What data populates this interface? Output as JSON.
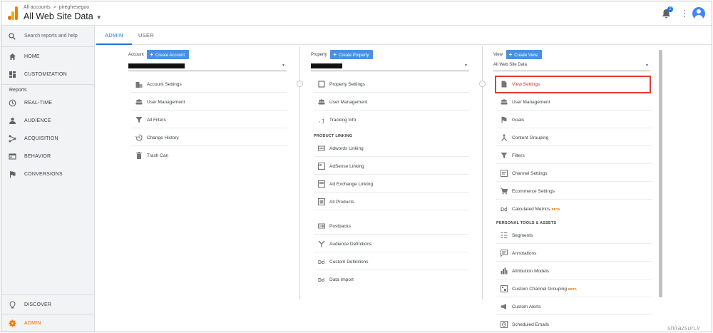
{
  "header": {
    "breadcrumb": [
      "All accounts",
      ">",
      "pireghesegoo"
    ],
    "title": "All Web Site Data",
    "notification_count": "2"
  },
  "search": {
    "placeholder": "Search reports and help"
  },
  "sidebar": {
    "home": "HOME",
    "customization": "CUSTOMIZATION",
    "reports_heading": "Reports",
    "realtime": "REAL-TIME",
    "audience": "AUDIENCE",
    "acquisition": "ACQUISITION",
    "behavior": "BEHAVIOR",
    "conversions": "CONVERSIONS",
    "discover": "DISCOVER",
    "admin": "ADMIN"
  },
  "tabs": {
    "admin": "ADMIN",
    "user": "USER"
  },
  "account": {
    "label": "Account",
    "create": "Create Account",
    "items": [
      "Account Settings",
      "User Management",
      "All Filters",
      "Change History",
      "Trash Can"
    ]
  },
  "property": {
    "label": "Property",
    "create": "Create Property",
    "items": [
      "Property Settings",
      "User Management",
      "Tracking Info"
    ],
    "linking_heading": "PRODUCT LINKING",
    "linking": [
      "Adwords Linking",
      "AdSense Linking",
      "Ad Exchange Linking",
      "All Products"
    ],
    "more": [
      "Postbacks",
      "Audience Definitions",
      "Custom Definitions",
      "Data Import"
    ]
  },
  "view": {
    "label": "View",
    "create": "Create View",
    "selected": "All Web Site Data",
    "items": [
      "View Settings",
      "User Management",
      "Goals",
      "Content Grouping",
      "Filters",
      "Channel Settings",
      "Ecommerce Settings",
      "Calculated Metrics"
    ],
    "calc_beta": "BETA",
    "tools_heading": "PERSONAL TOOLS & ASSETS",
    "tools": [
      "Segments",
      "Annotations",
      "Attribution Models",
      "Custom Channel Grouping",
      "Custom Alerts",
      "Scheduled Emails"
    ],
    "ccg_beta": "BETA"
  },
  "watermark": "shirazsun.ir",
  "colors": {
    "accent": "#1a73e8",
    "admin_orange": "#e37400",
    "highlight": "#e53935",
    "button": "#4a90e2"
  }
}
